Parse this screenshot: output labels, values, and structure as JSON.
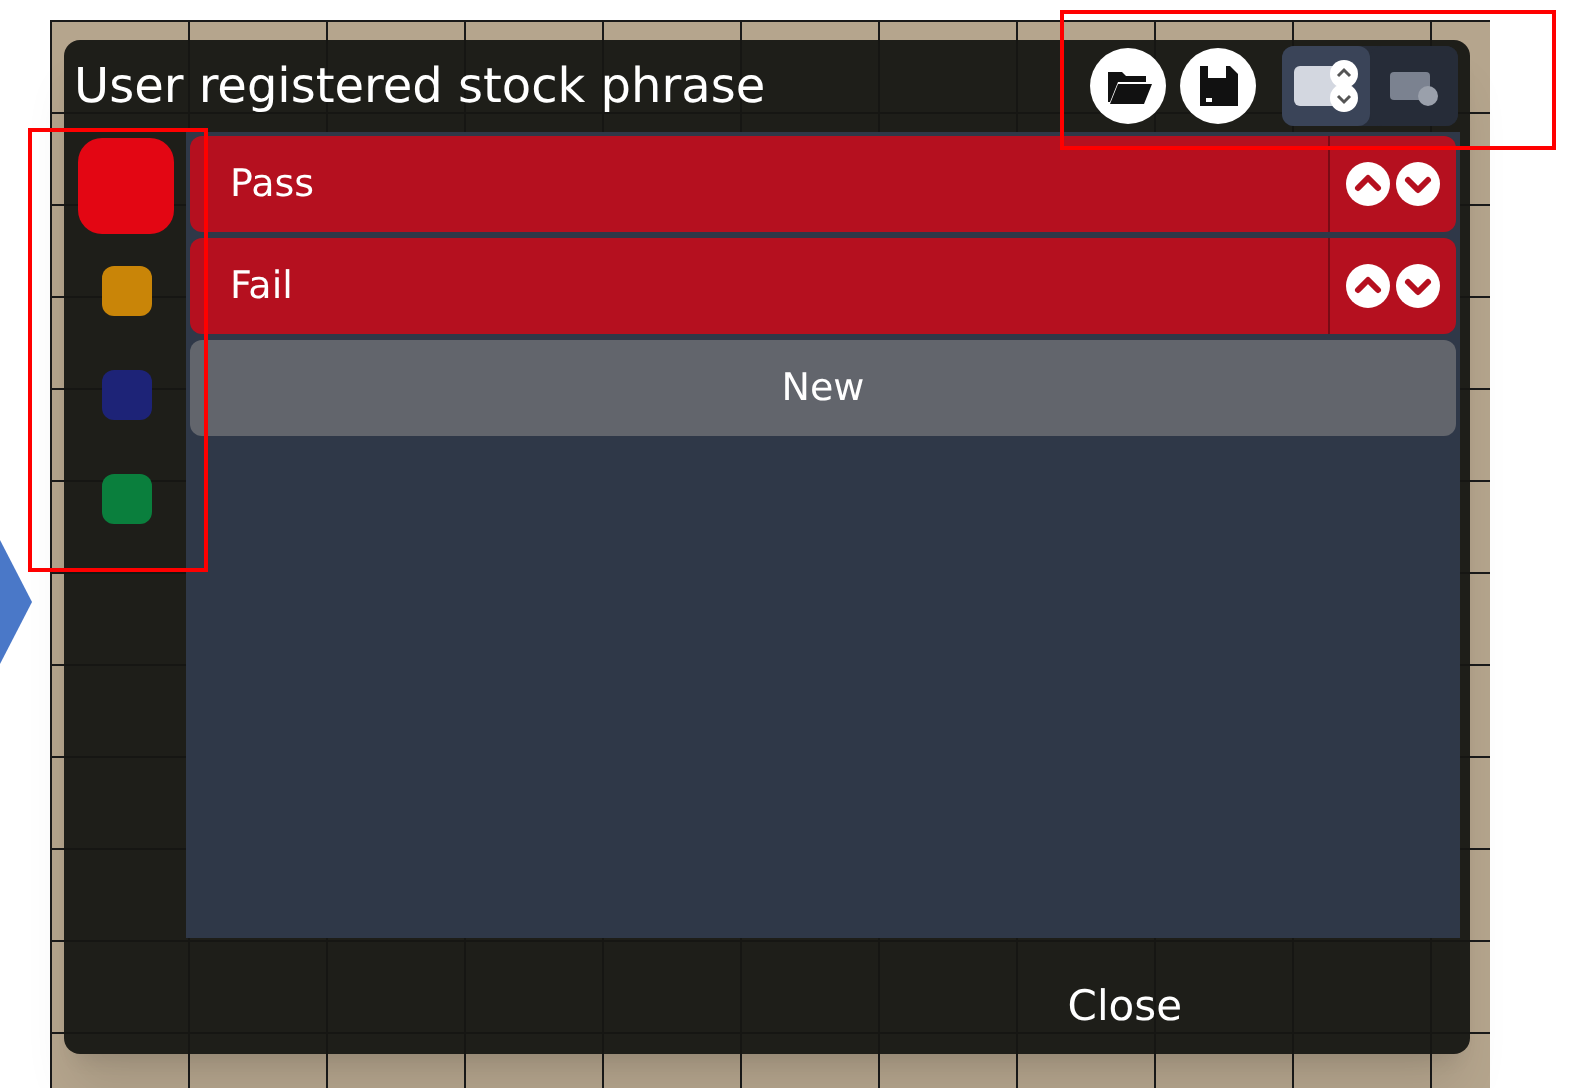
{
  "dialog": {
    "title": "User registered stock phrase",
    "toolbar": {
      "buttons": [
        {
          "kind": "open"
        },
        {
          "kind": "save"
        }
      ],
      "view_modes": [
        {
          "kind": "reorder",
          "selected": true
        },
        {
          "kind": "delete",
          "selected": false
        }
      ]
    },
    "swatches": [
      {
        "color": "#e30613",
        "selected": true
      },
      {
        "color": "#c98508",
        "selected": false
      },
      {
        "color": "#1d2377",
        "selected": false
      },
      {
        "color": "#0a7f3d",
        "selected": false
      }
    ],
    "phrases": [
      {
        "label": "Pass",
        "color": "#b5101f"
      },
      {
        "label": "Fail",
        "color": "#b5101f"
      }
    ],
    "new_button": "New",
    "close_button": "Close"
  }
}
